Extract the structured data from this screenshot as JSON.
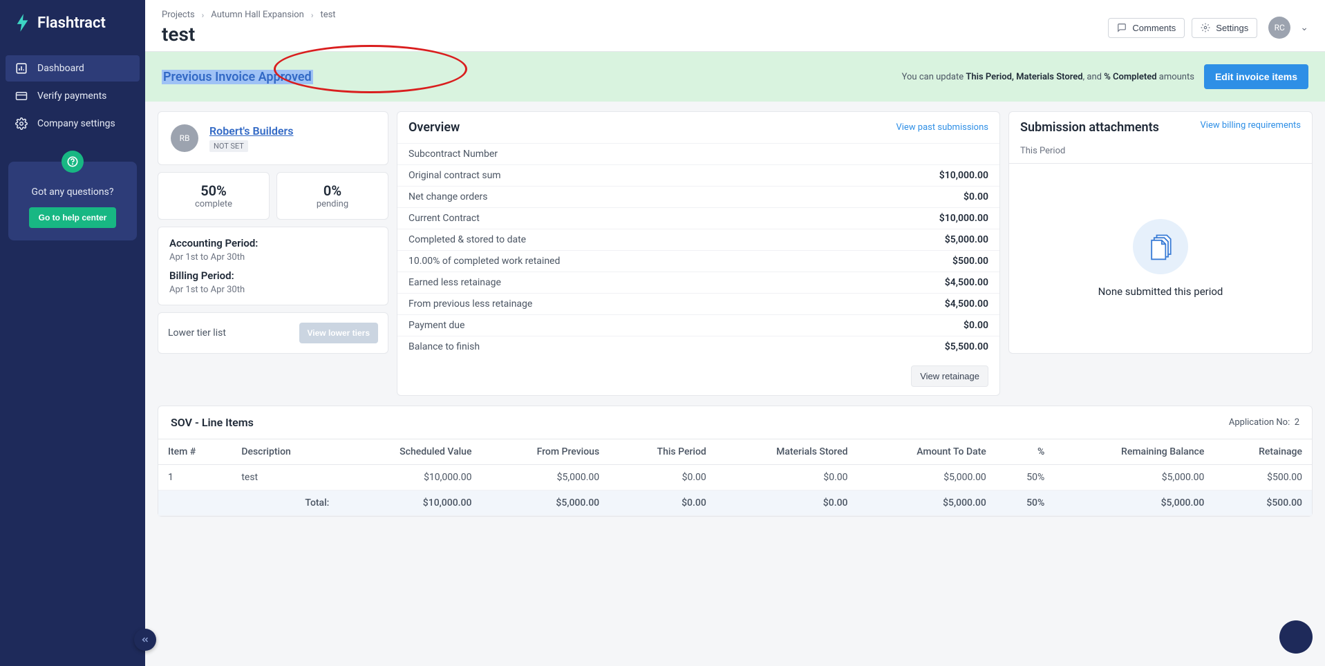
{
  "brand": "Flashtract",
  "sidebar": {
    "items": [
      {
        "label": "Dashboard"
      },
      {
        "label": "Verify payments"
      },
      {
        "label": "Company settings"
      }
    ],
    "help_question": "Got any questions?",
    "help_button": "Go to help center"
  },
  "breadcrumb": {
    "items": [
      {
        "label": "Projects"
      },
      {
        "label": "Autumn Hall Expansion"
      },
      {
        "label": "test"
      }
    ]
  },
  "page_title": "test",
  "header": {
    "comments": "Comments",
    "settings": "Settings",
    "user_initials": "RC"
  },
  "approval": {
    "banner_text": "Previous Invoice Approved",
    "hint_prefix": "You can update ",
    "hint_bold1": "This Period, Materials Stored",
    "hint_mid": ", and ",
    "hint_bold2": "% Completed",
    "hint_suffix": " amounts",
    "edit_button": "Edit invoice items"
  },
  "builder": {
    "avatar": "RB",
    "name": "Robert's Builders",
    "tag": "NOT SET"
  },
  "stats": {
    "complete_val": "50%",
    "complete_lbl": "complete",
    "pending_val": "0%",
    "pending_lbl": "pending"
  },
  "periods": {
    "accounting_title": "Accounting Period:",
    "accounting_sub": "Apr 1st to Apr 30th",
    "billing_title": "Billing Period:",
    "billing_sub": "Apr 1st to Apr 30th"
  },
  "lower": {
    "title": "Lower tier list",
    "button": "View lower tiers"
  },
  "overview": {
    "title": "Overview",
    "past_link": "View past submissions",
    "rows": [
      {
        "label": "Subcontract Number",
        "value": ""
      },
      {
        "label": "Original contract sum",
        "value": "$10,000.00"
      },
      {
        "label": "Net change orders",
        "value": "$0.00"
      },
      {
        "label": "Current Contract",
        "value": "$10,000.00"
      },
      {
        "label": "Completed & stored to date",
        "value": "$5,000.00"
      },
      {
        "label": "10.00% of completed work retained",
        "value": "$500.00"
      },
      {
        "label": "Earned less retainage",
        "value": "$4,500.00"
      },
      {
        "label": "From previous less retainage",
        "value": "$4,500.00"
      },
      {
        "label": "Payment due",
        "value": "$0.00"
      },
      {
        "label": "Balance to finish",
        "value": "$5,500.00"
      }
    ],
    "view_retainage": "View retainage"
  },
  "attachments": {
    "title": "Submission attachments",
    "link": "View billing requirements",
    "sub": "This Period",
    "empty": "None submitted this period"
  },
  "sov": {
    "title": "SOV - Line Items",
    "app_label": "Application No:",
    "app_no": "2",
    "headers": [
      "Item #",
      "Description",
      "Scheduled Value",
      "From Previous",
      "This Period",
      "Materials Stored",
      "Amount To Date",
      "%",
      "Remaining Balance",
      "Retainage"
    ],
    "rows": [
      {
        "item": "1",
        "desc": "test",
        "sched": "$10,000.00",
        "prev": "$5,000.00",
        "period": "$0.00",
        "mat": "$0.00",
        "todate": "$5,000.00",
        "pct": "50%",
        "remain": "$5,000.00",
        "ret": "$500.00"
      }
    ],
    "total_label": "Total:",
    "totals": {
      "sched": "$10,000.00",
      "prev": "$5,000.00",
      "period": "$0.00",
      "mat": "$0.00",
      "todate": "$5,000.00",
      "pct": "50%",
      "remain": "$5,000.00",
      "ret": "$500.00"
    }
  }
}
